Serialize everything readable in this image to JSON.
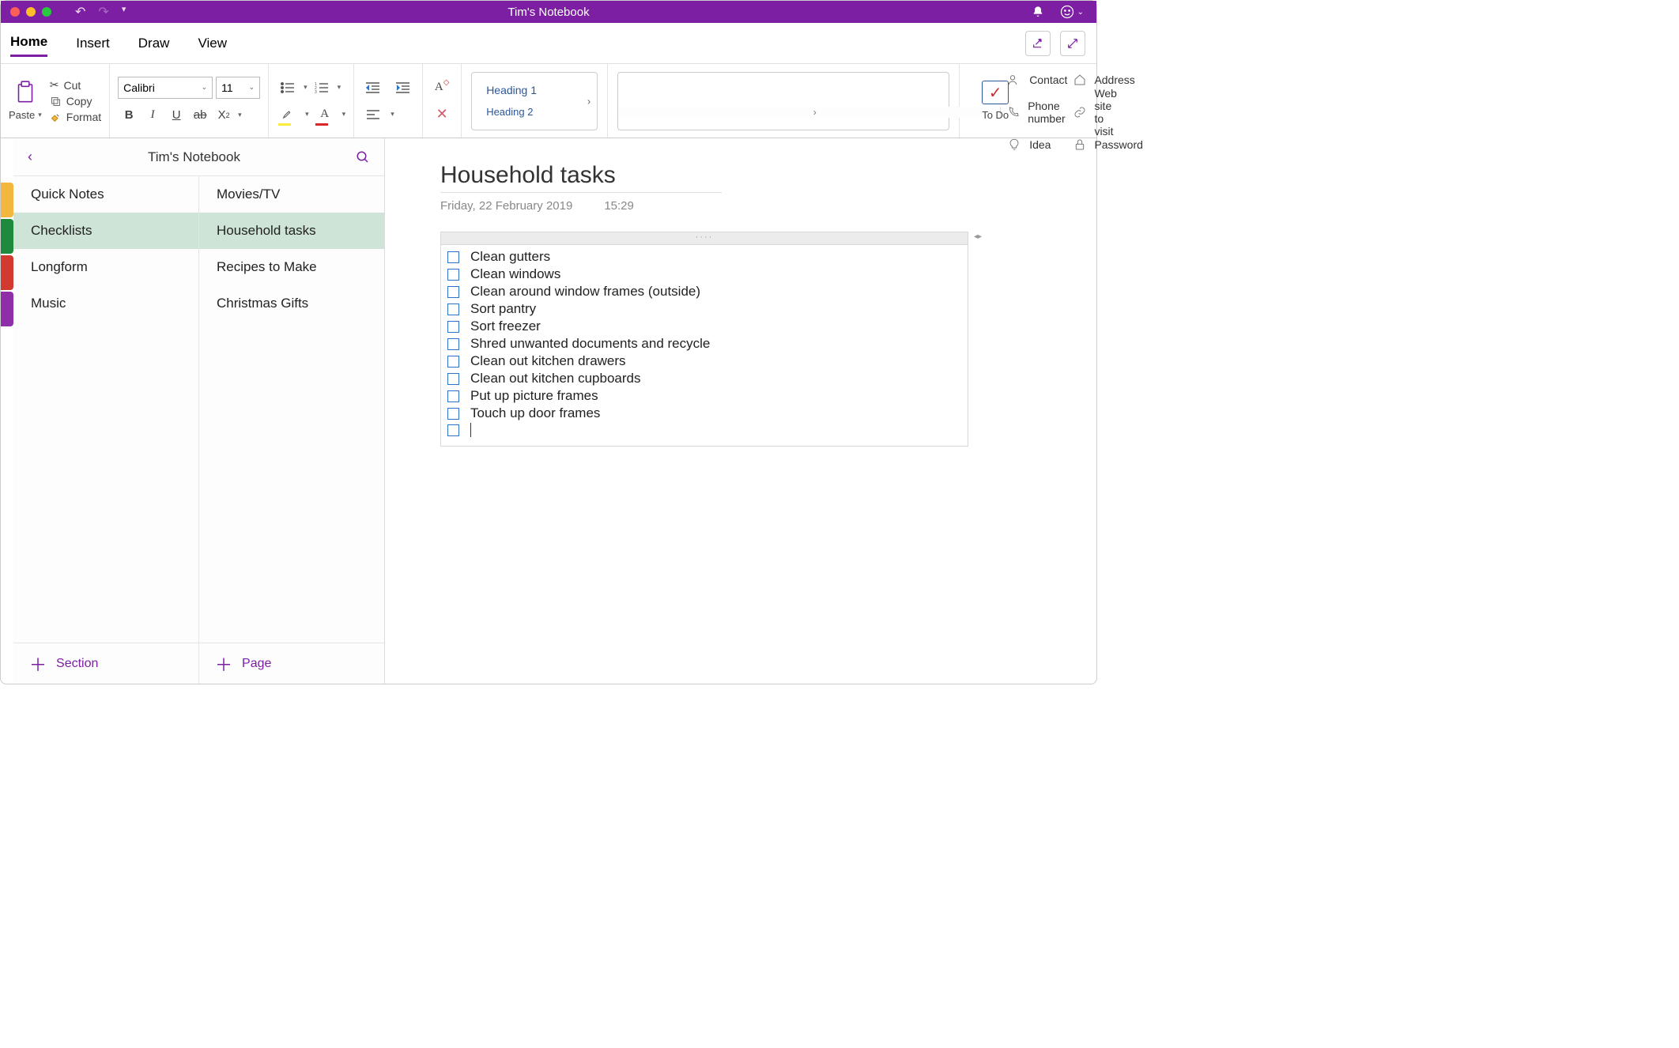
{
  "window_title": "Tim's Notebook",
  "tabs": {
    "home": "Home",
    "insert": "Insert",
    "draw": "Draw",
    "view": "View"
  },
  "clipboard": {
    "paste": "Paste",
    "cut": "Cut",
    "copy": "Copy",
    "format": "Format"
  },
  "font": {
    "name": "Calibri",
    "size": "11"
  },
  "styles": {
    "h1": "Heading 1",
    "h2": "Heading 2"
  },
  "tags": {
    "contact": "Contact",
    "phone": "Phone number",
    "idea": "Idea",
    "address": "Address",
    "web": "Web site to visit",
    "password": "Password"
  },
  "todo_label": "To Do",
  "notebook_name": "Tim's Notebook",
  "sections": [
    "Quick Notes",
    "Checklists",
    "Longform",
    "Music"
  ],
  "section_colors": [
    "#f3b73e",
    "#1e8a3c",
    "#d33a2f",
    "#8e2ea8"
  ],
  "pages": [
    "Movies/TV",
    "Household tasks",
    "Recipes to Make",
    "Christmas Gifts"
  ],
  "add_section": "Section",
  "add_page": "Page",
  "page_title": "Household tasks",
  "page_date": "Friday, 22 February 2019",
  "page_time": "15:29",
  "tasks": [
    "Clean gutters",
    "Clean windows",
    "Clean around window frames (outside)",
    "Sort pantry",
    "Sort freezer",
    "Shred unwanted documents and recycle",
    "Clean out kitchen drawers",
    "Clean out kitchen cupboards",
    "Put up picture frames",
    "Touch up door frames"
  ]
}
